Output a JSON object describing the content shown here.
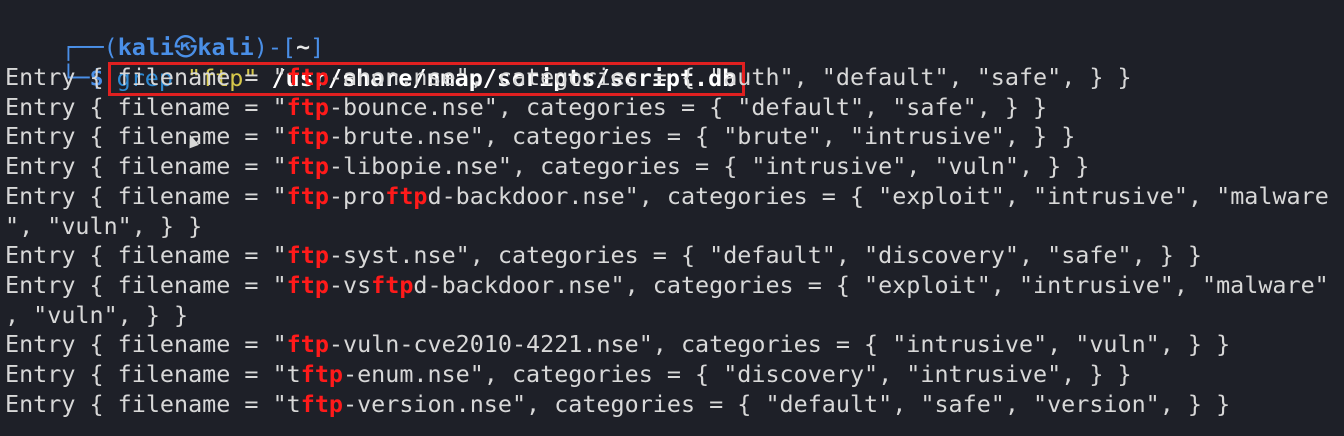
{
  "prompt": {
    "top_left": "┌──(",
    "user": "kali",
    "skull": "㉿",
    "host": "kali",
    "mid": ")-[",
    "dir": "~",
    "end": "]",
    "bottom_left": "└─",
    "dollar": "$"
  },
  "command": {
    "cmd": "grep",
    "pattern": "\"ftp\"",
    "path": "/usr/share/nmap/scripts/script.db"
  },
  "output": {
    "highlight": "ftp",
    "lines": [
      {
        "pre": "Entry { filename = \"",
        "hl": "ftp",
        "post": "-anon.nse\", categories = { \"auth\", \"default\", \"safe\", } }"
      },
      {
        "pre": "Entry { filename = \"",
        "hl": "ftp",
        "post": "-bounce.nse\", categories = { \"default\", \"safe\", } }"
      },
      {
        "pre": "Entry { filename = \"",
        "hl": "ftp",
        "post": "-brute.nse\", categories = { \"brute\", \"intrusive\", } }"
      },
      {
        "pre": "Entry { filename = \"",
        "hl": "ftp",
        "post": "-libopie.nse\", categories = { \"intrusive\", \"vuln\", } }"
      },
      {
        "pre": "Entry { filename = \"",
        "hl": "ftp",
        "mid": "-pro",
        "hl2": "ftp",
        "post": "d-backdoor.nse\", categories = { \"exploit\", \"intrusive\", \"malware"
      },
      {
        "pre": "\", \"vuln\", } }"
      },
      {
        "pre": "Entry { filename = \"",
        "hl": "ftp",
        "post": "-syst.nse\", categories = { \"default\", \"discovery\", \"safe\", } }"
      },
      {
        "pre": "Entry { filename = \"",
        "hl": "ftp",
        "mid": "-vs",
        "hl2": "ftp",
        "post": "d-backdoor.nse\", categories = { \"exploit\", \"intrusive\", \"malware\""
      },
      {
        "pre": ", \"vuln\", } }"
      },
      {
        "pre": "Entry { filename = \"",
        "hl": "ftp",
        "post": "-vuln-cve2010-4221.nse\", categories = { \"intrusive\", \"vuln\", } }"
      },
      {
        "pre": "Entry { filename = \"t",
        "hl": "ftp",
        "post": "-enum.nse\", categories = { \"discovery\", \"intrusive\", } }"
      },
      {
        "pre": "Entry { filename = \"t",
        "hl": "ftp",
        "post": "-version.nse\", categories = { \"default\", \"safe\", \"version\", } }"
      }
    ]
  },
  "colors": {
    "background": "#1e2028",
    "prompt": "#4a8fe7",
    "match": "#ff1a1a",
    "box": "#e02020"
  },
  "icons": {
    "cursor": "mouse-pointer-icon"
  }
}
